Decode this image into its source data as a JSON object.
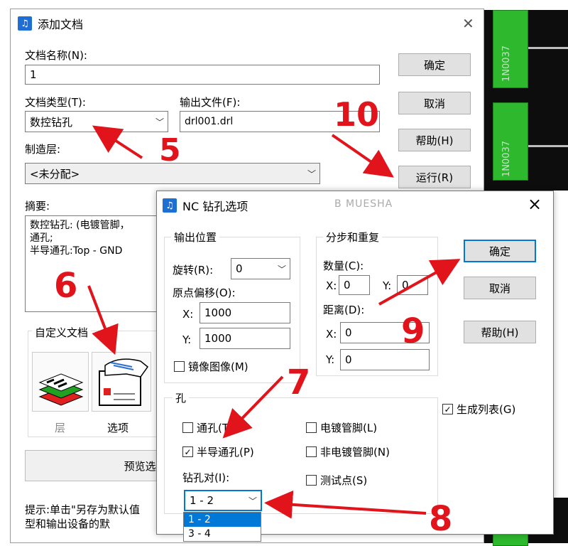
{
  "pcb_panel": {
    "labels": [
      "1N0037",
      "1N0037"
    ]
  },
  "add_doc": {
    "title": "添加文档",
    "doc_name_label": "文档名称(N):",
    "doc_name_value": "1",
    "doc_type_label": "文档类型(T):",
    "doc_type_value": "数控钻孔",
    "output_file_label": "输出文件(F):",
    "output_file_value": "drl001.drl",
    "layer_label": "制造层:",
    "layer_value": "<未分配>",
    "summary_label": "摘要:",
    "summary_text": "数控钻孔: (电镀管脚，\n通孔;\n半导通孔:Top - GND",
    "custom_doc_label": "自定义文档",
    "layers_label": "层",
    "options_label": "选项",
    "preview_button": "预览选择(P)",
    "hint": "提示:单击\"另存为默认值\n型和输出设备的默",
    "buttons": {
      "ok": "确定",
      "cancel": "取消",
      "help": "帮助(H)",
      "run": "运行(R)"
    }
  },
  "nc_dialog": {
    "title": "NC 钻孔选项",
    "watermark": "B MUESHA",
    "close": "×",
    "output_pos": {
      "title": "输出位置",
      "rotate_label": "旋转(R):",
      "rotate_value": "0",
      "origin_label": "原点偏移(O):",
      "x_label": "X:",
      "x_value": "1000",
      "y_label": "Y:",
      "y_value": "1000",
      "mirror_label": "镜像图像(M)"
    },
    "step_repeat": {
      "title": "分步和重复",
      "count_label": "数量(C):",
      "cx_label": "X:",
      "cx_value": "0",
      "cy_label": "Y:",
      "cy_value": "0",
      "dist_label": "距离(D):",
      "dx_label": "X:",
      "dx_value": "0",
      "dy_label": "Y:",
      "dy_value": "0"
    },
    "holes": {
      "title": "孔",
      "through": "通孔(T)",
      "semi_through": "半导通孔(P)",
      "plated_pins": "电镀管脚(L)",
      "nonplated_pins": "非电镀管脚(N)",
      "test_points": "测试点(S)",
      "drill_pair_label": "钻孔对(I):",
      "drill_pair_value": "1 - 2",
      "drill_pair_options": [
        "1 - 2",
        "3 - 4"
      ]
    },
    "generate_list": "生成列表(G)",
    "buttons": {
      "ok": "确定",
      "cancel": "取消",
      "help": "帮助(H)"
    }
  },
  "annotations": {
    "n5": "5",
    "n6": "6",
    "n7": "7",
    "n8": "8",
    "n9": "9",
    "n10": "10"
  },
  "colors": {
    "arrow": "#e1141b",
    "accent": "#0078d7",
    "pcb_pad": "#2db82d"
  }
}
